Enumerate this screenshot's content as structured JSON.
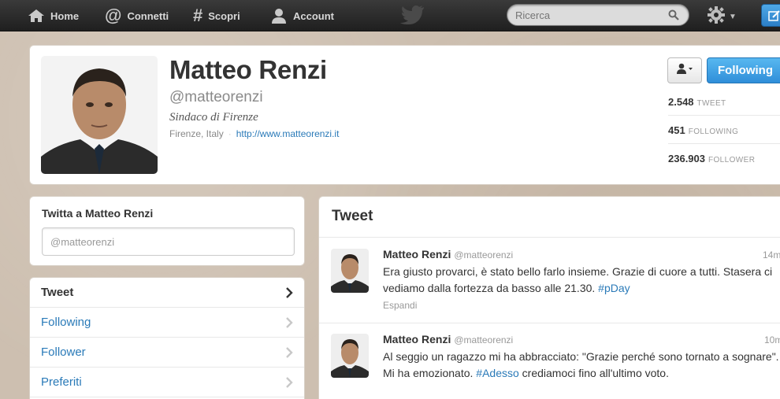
{
  "topbar": {
    "nav": [
      {
        "label": "Home",
        "icon": "home-icon"
      },
      {
        "label": "Connetti",
        "icon": "at-icon"
      },
      {
        "label": "Scopri",
        "icon": "hash-icon"
      },
      {
        "label": "Account",
        "icon": "person-icon"
      }
    ],
    "search_placeholder": "Ricerca"
  },
  "profile": {
    "name": "Matteo Renzi",
    "handle": "@matteorenzi",
    "bio": "Sindaco di Firenze",
    "location": "Firenze, Italy",
    "url": "http://www.matteorenzi.it",
    "follow_label": "Following",
    "stats": [
      {
        "value": "2.548",
        "label": "TWEET"
      },
      {
        "value": "451",
        "label": "FOLLOWING"
      },
      {
        "value": "236.903",
        "label": "FOLLOWER"
      }
    ]
  },
  "tweet_box": {
    "title": "Twitta a Matteo Renzi",
    "value": "@matteorenzi"
  },
  "sidebar": {
    "items": [
      {
        "label": "Tweet",
        "active": true
      },
      {
        "label": "Following",
        "active": false
      },
      {
        "label": "Follower",
        "active": false
      },
      {
        "label": "Preferiti",
        "active": false
      }
    ]
  },
  "stream": {
    "title": "Tweet",
    "tweets": [
      {
        "name": "Matteo Renzi",
        "handle": "@matteorenzi",
        "time": "14m",
        "text_pre": "Era giusto provarci, è stato bello farlo insieme. Grazie di cuore a tutti. Stasera ci vediamo dalla fortezza da basso alle 21.30.",
        "hashtag": "#pDay",
        "text_post": "",
        "expand": "Espandi"
      },
      {
        "name": "Matteo Renzi",
        "handle": "@matteorenzi",
        "time": "10m",
        "text_pre": "Al seggio un ragazzo mi ha abbracciato: \"Grazie perché sono tornato a sognare\". Mi ha emozionato.",
        "hashtag": "#Adesso",
        "text_post": "crediamoci fino all'ultimo voto.",
        "expand": ""
      }
    ]
  },
  "colors": {
    "link": "#2a7ab8",
    "follow_button": "#2f8ed9",
    "topbar": "#262626"
  }
}
